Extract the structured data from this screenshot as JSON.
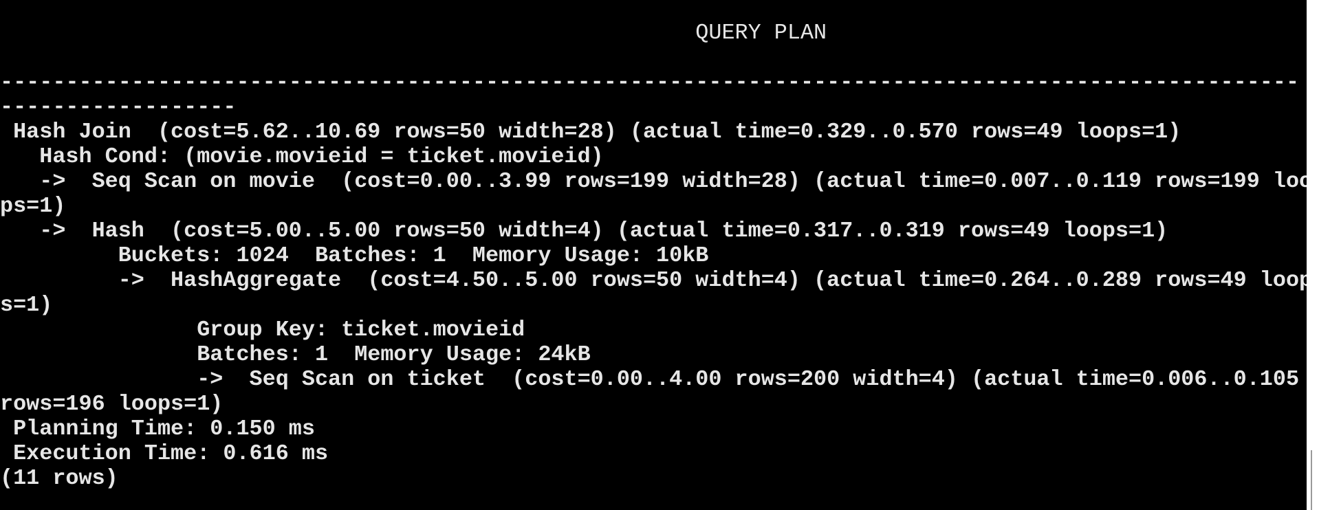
{
  "terminal": {
    "lines": [
      "                                                     QUERY PLAN",
      "",
      "---------------------------------------------------------------------------------------------------",
      "------------------",
      " Hash Join  (cost=5.62..10.69 rows=50 width=28) (actual time=0.329..0.570 rows=49 loops=1)",
      "   Hash Cond: (movie.movieid = ticket.movieid)",
      "   ->  Seq Scan on movie  (cost=0.00..3.99 rows=199 width=28) (actual time=0.007..0.119 rows=199 loo",
      "ps=1)",
      "   ->  Hash  (cost=5.00..5.00 rows=50 width=4) (actual time=0.317..0.319 rows=49 loops=1)",
      "         Buckets: 1024  Batches: 1  Memory Usage: 10kB",
      "         ->  HashAggregate  (cost=4.50..5.00 rows=50 width=4) (actual time=0.264..0.289 rows=49 loop",
      "s=1)",
      "               Group Key: ticket.movieid",
      "               Batches: 1  Memory Usage: 24kB",
      "               ->  Seq Scan on ticket  (cost=0.00..4.00 rows=200 width=4) (actual time=0.006..0.105",
      "rows=196 loops=1)",
      " Planning Time: 0.150 ms",
      " Execution Time: 0.616 ms",
      "(11 rows)"
    ]
  }
}
